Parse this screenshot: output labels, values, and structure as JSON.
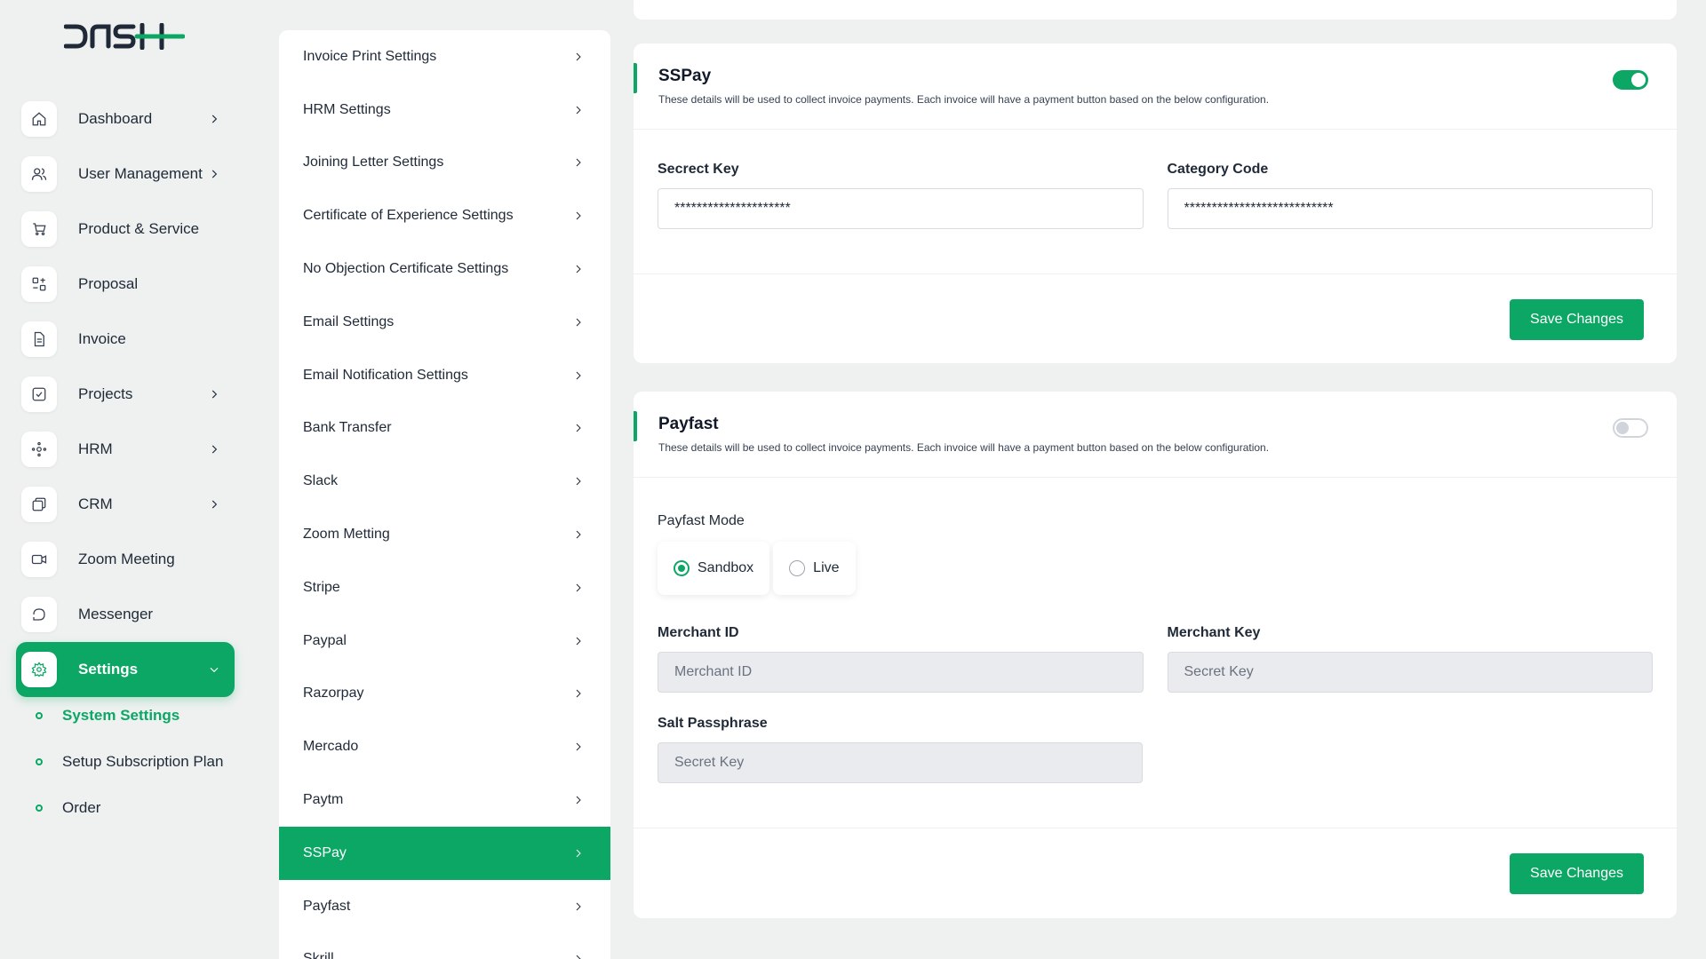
{
  "brand": {
    "logo_text": "DASH"
  },
  "sidebar": {
    "items": [
      {
        "label": "Dashboard",
        "icon": "home-icon",
        "has_chevron": true
      },
      {
        "label": "User Management",
        "icon": "users-icon",
        "has_chevron": true
      },
      {
        "label": "Product & Service",
        "icon": "cart-icon",
        "has_chevron": false
      },
      {
        "label": "Proposal",
        "icon": "proposal-icon",
        "has_chevron": false
      },
      {
        "label": "Invoice",
        "icon": "invoice-icon",
        "has_chevron": false
      },
      {
        "label": "Projects",
        "icon": "projects-icon",
        "has_chevron": true
      },
      {
        "label": "HRM",
        "icon": "hrm-icon",
        "has_chevron": true
      },
      {
        "label": "CRM",
        "icon": "crm-icon",
        "has_chevron": true
      },
      {
        "label": "Zoom Meeting",
        "icon": "video-icon",
        "has_chevron": false
      },
      {
        "label": "Messenger",
        "icon": "chat-icon",
        "has_chevron": false
      },
      {
        "label": "Settings",
        "icon": "gear-icon",
        "has_chevron": true,
        "active": true
      }
    ],
    "sub_items": [
      {
        "label": "System Settings",
        "active": true
      },
      {
        "label": "Setup Subscription Plan",
        "active": false
      },
      {
        "label": "Order",
        "active": false
      }
    ]
  },
  "settings_menu": {
    "items": [
      "Invoice Print Settings",
      "HRM Settings",
      "Joining Letter Settings",
      "Certificate of Experience Settings",
      "No Objection Certificate Settings",
      "Email Settings",
      "Email Notification Settings",
      "Bank Transfer",
      "Slack",
      "Zoom Metting",
      "Stripe",
      "Paypal",
      "Razorpay",
      "Mercado",
      "Paytm",
      "SSPay",
      "Payfast",
      "Skrill"
    ],
    "active_index": 15
  },
  "sspay": {
    "title": "SSPay",
    "description": "These details will be used to collect invoice payments. Each invoice will have a payment button based on the below configuration.",
    "enabled": true,
    "secret_key_label": "Secrect Key",
    "secret_key_value": "*********************",
    "category_code_label": "Category Code",
    "category_code_value": "***************************",
    "save_label": "Save Changes"
  },
  "payfast": {
    "title": "Payfast",
    "description": "These details will be used to collect invoice payments. Each invoice will have a payment button based on the below configuration.",
    "enabled": false,
    "mode_label": "Payfast Mode",
    "mode_sandbox": "Sandbox",
    "mode_live": "Live",
    "selected_mode": "Sandbox",
    "merchant_id_label": "Merchant ID",
    "merchant_id_placeholder": "Merchant ID",
    "merchant_key_label": "Merchant Key",
    "merchant_key_placeholder": "Secret Key",
    "salt_label": "Salt Passphrase",
    "salt_placeholder": "Secret Key",
    "save_label": "Save Changes"
  },
  "colors": {
    "accent": "#0ca665",
    "background": "#eef1f0"
  }
}
